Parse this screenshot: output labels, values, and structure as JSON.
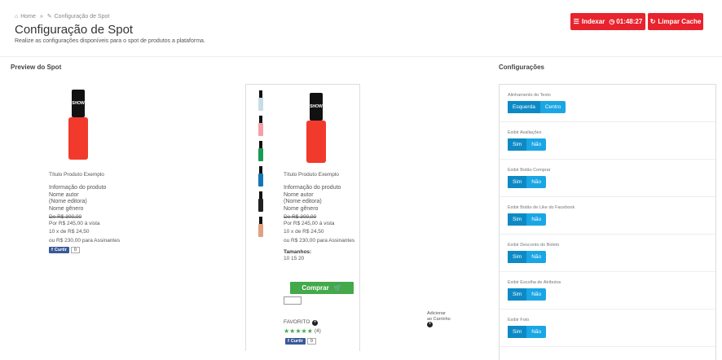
{
  "breadcrumb": {
    "home": "Home",
    "separator": "»",
    "current": "Configuração de Spot"
  },
  "header": {
    "title": "Configuração de Spot",
    "subtitle": "Realize as configurações disponíveis para o spot de produtos a plataforma.",
    "index_button": "Indexar",
    "timer": "01:48:27",
    "clear_cache_button": "Limpar Cache"
  },
  "preview": {
    "section_title": "Preview do Spot",
    "product": {
      "title": "Título Produto Exemplo",
      "info_lines": [
        "Informação do produto",
        "Nome autor",
        "(Nome editora)",
        "Nome gênero"
      ],
      "old_price": "De R$ 300,00",
      "price": "Por R$ 245,00 à vista",
      "installments": "10 x de R$ 24,50",
      "subscriber_price": "ou R$ 230,00 para Assinantes",
      "sizes_label": "Tamanhos:",
      "sizes_values": "10 15 20",
      "buy_button": "Comprar",
      "favorite_label": "FAVORITO",
      "rating_count": "(4)",
      "add_to_cart": "Adicionar ao Carrinho"
    },
    "like_label": "Curtir",
    "like_count": "0",
    "thumb_colors": [
      "#c8dce8",
      "#f3a0a6",
      "#1a9a55",
      "#1276b8",
      "#222222",
      "#e2a080"
    ],
    "accent_red": "#e8232e",
    "bottle_red": "#f23a2c"
  },
  "config": {
    "section_title": "Configurações",
    "items": [
      {
        "label": "Alinhamento do Texto",
        "options": [
          "Esquerda",
          "Centro"
        ],
        "selected": 0
      },
      {
        "label": "Exibir Avaliações",
        "options": [
          "Sim",
          "Não"
        ],
        "selected": 0
      },
      {
        "label": "Exibir Botão Comprar",
        "options": [
          "Sim",
          "Não"
        ],
        "selected": 0
      },
      {
        "label": "Exibir Botão de Like do Facebook",
        "options": [
          "Sim",
          "Não"
        ],
        "selected": 0
      },
      {
        "label": "Exibir Desconto do Boleto",
        "options": [
          "Sim",
          "Não"
        ],
        "selected": 0
      },
      {
        "label": "Exibir Escolha de Atributos",
        "options": [
          "Sim",
          "Não"
        ],
        "selected": 0
      },
      {
        "label": "Exibir Foto",
        "options": [
          "Sim",
          "Não"
        ],
        "selected": 0
      }
    ]
  }
}
